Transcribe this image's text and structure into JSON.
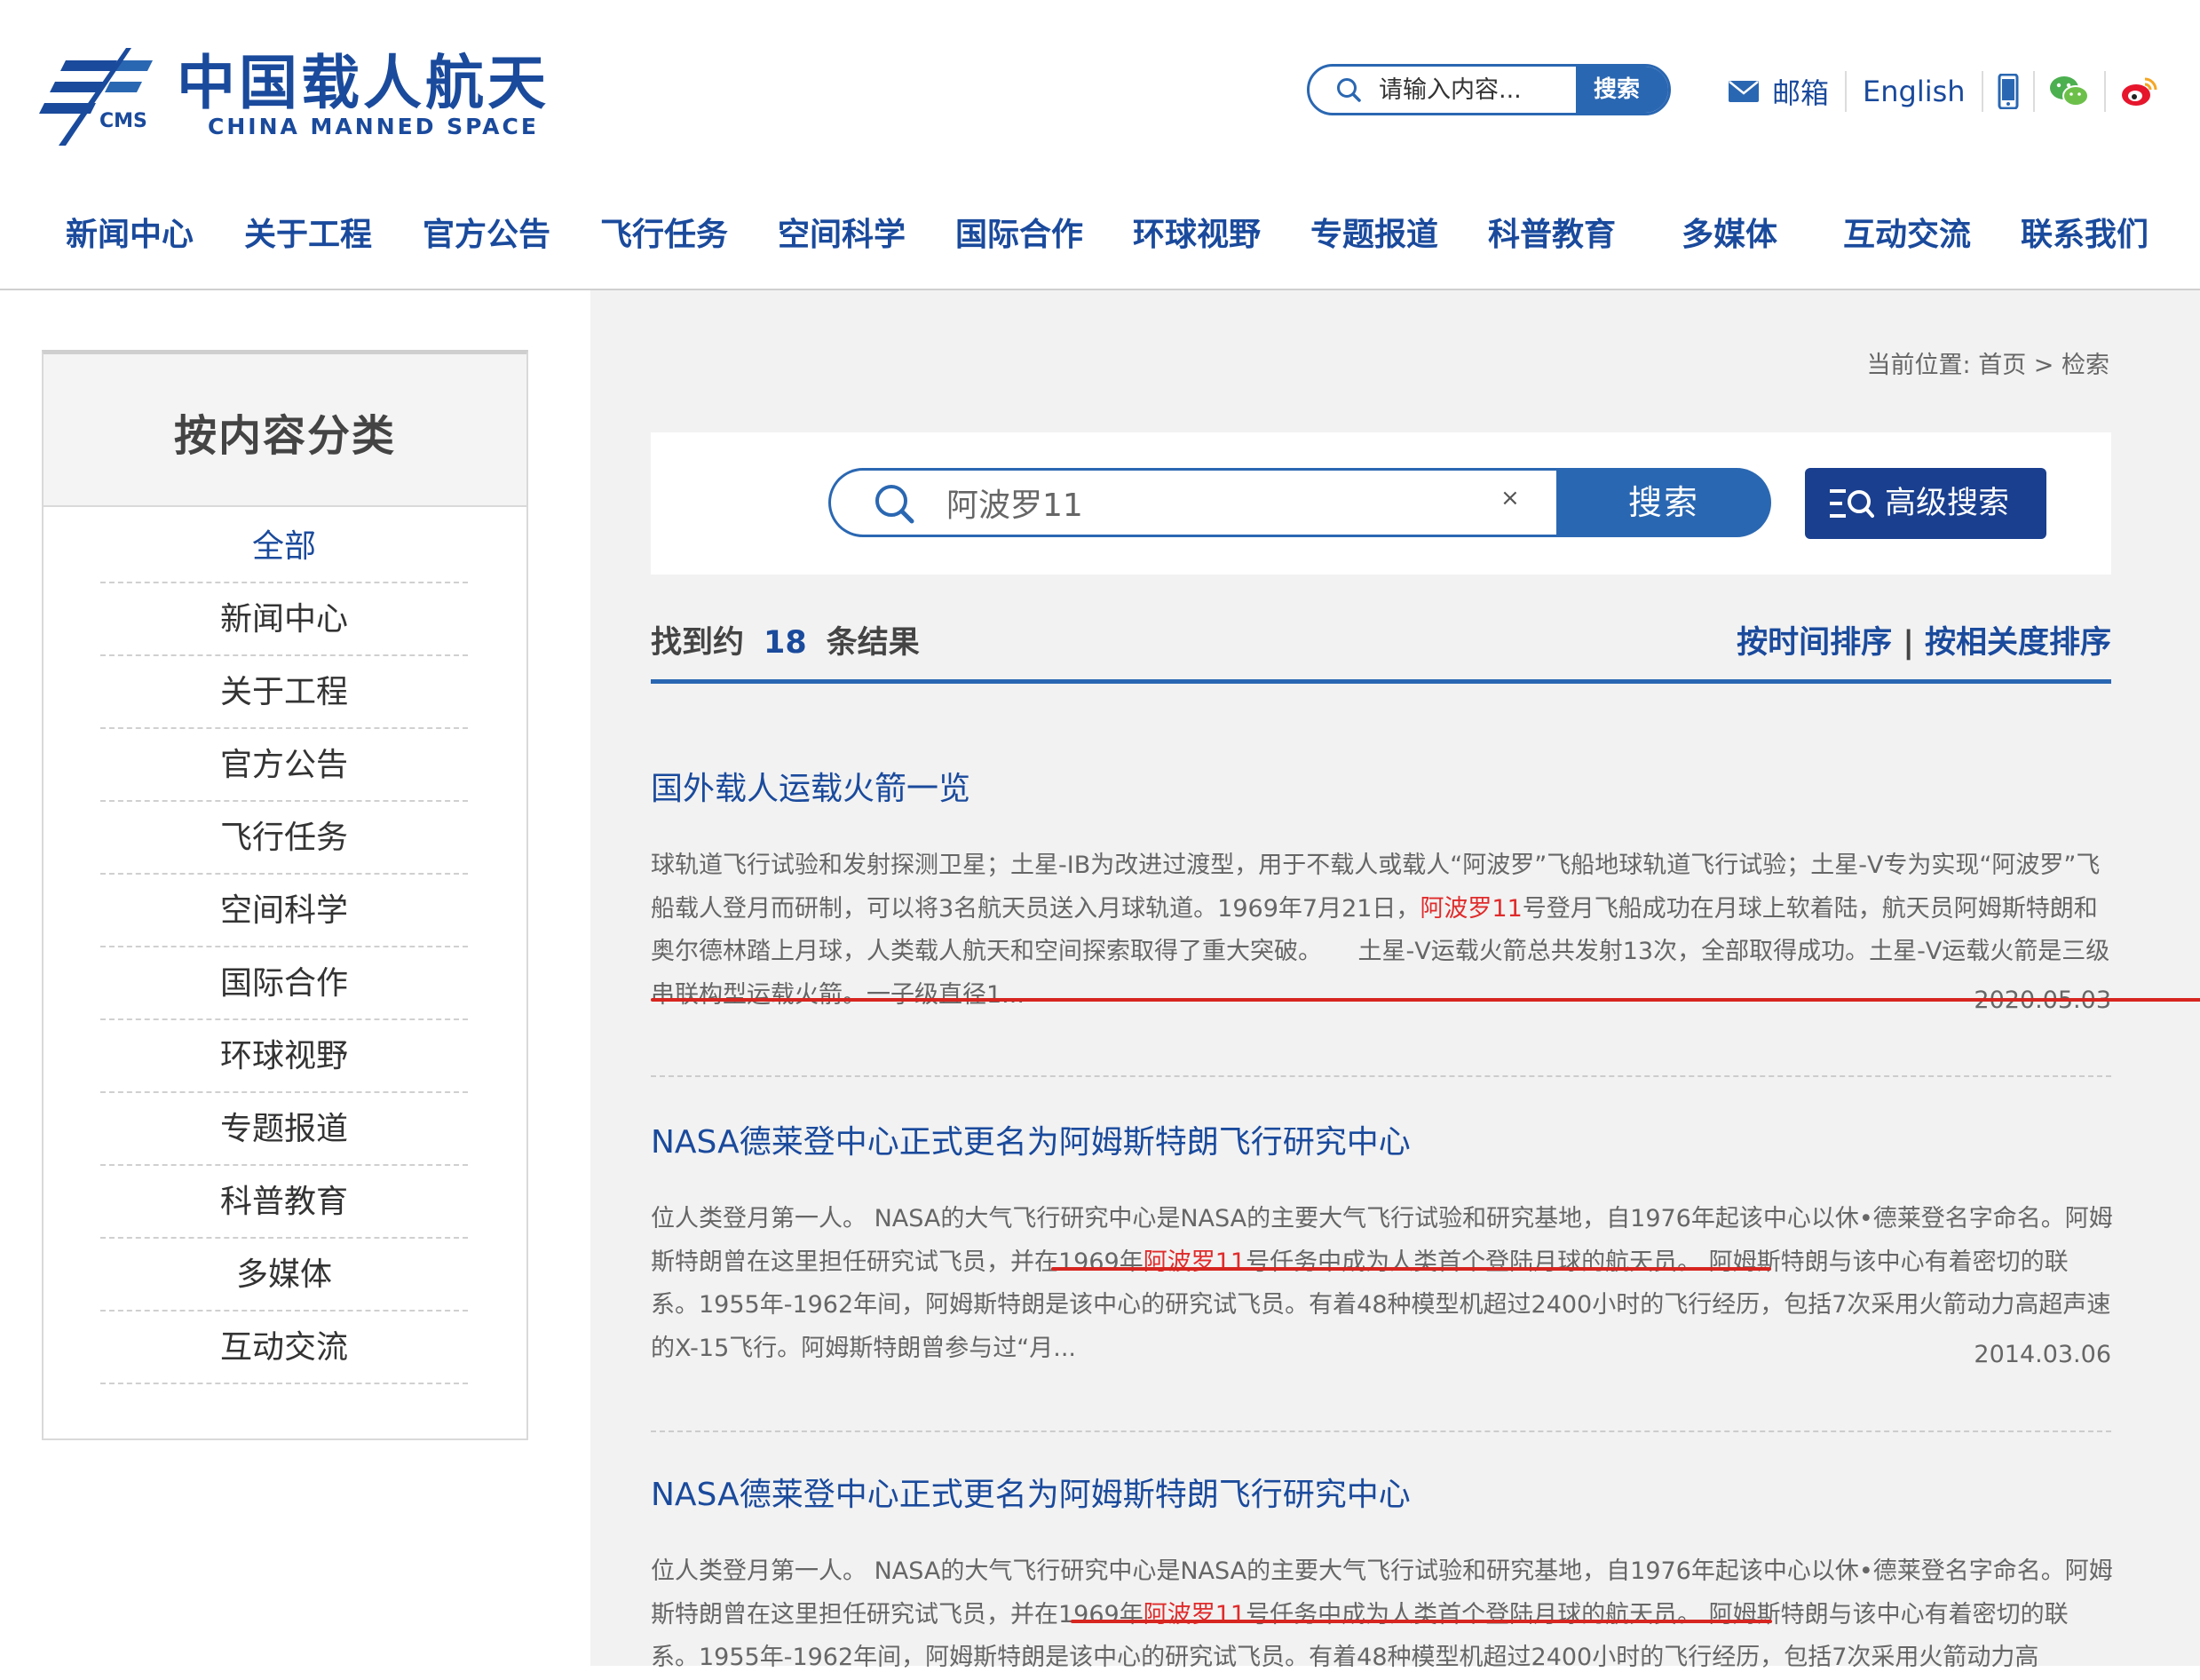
{
  "header": {
    "logo_cn": "中国载人航天",
    "logo_en": "CHINA MANNED SPACE",
    "logo_cms": "CMS",
    "search_placeholder": "请输入内容...",
    "search_button": "搜索",
    "mail_label": "邮箱",
    "english_label": "English",
    "icons": [
      "mail-icon",
      "phone-icon",
      "wechat-icon",
      "weibo-icon"
    ]
  },
  "nav": [
    "新闻中心",
    "关于工程",
    "官方公告",
    "飞行任务",
    "空间科学",
    "国际合作",
    "环球视野",
    "专题报道",
    "科普教育",
    "多媒体",
    "互动交流",
    "联系我们"
  ],
  "sidebar": {
    "title": "按内容分类",
    "items": [
      "全部",
      "新闻中心",
      "关于工程",
      "官方公告",
      "飞行任务",
      "空间科学",
      "国际合作",
      "环球视野",
      "专题报道",
      "科普教育",
      "多媒体",
      "互动交流"
    ],
    "active": "全部"
  },
  "breadcrumb": "当前位置: 首页 > 检索",
  "search": {
    "query": "阿波罗11",
    "clear": "×",
    "button": "搜索",
    "advanced": "高级搜索"
  },
  "results_header": {
    "prefix": "找到约",
    "count": "18",
    "suffix": "条结果",
    "sort_time": "按时间排序",
    "sort_sep": "|",
    "sort_relevance": "按相关度排序"
  },
  "results": [
    {
      "title": "国外载人运载火箭一览",
      "snippet_before": "球轨道飞行试验和发射探测卫星；土星-IB为改进过渡型，用于不载人或载人“阿波罗”飞船地球轨道飞行试验；土星-V专为实现“阿波罗”飞船载人登月而研制，可以将3名航天员送入月球轨道。1969年7月21日，",
      "highlight": "阿波罗11",
      "snippet_after": "号登月飞船成功在月球上软着陆，航天员阿姆斯特朗和奥尔德林踏上月球，人类载人航天和空间探索取得了重大突破。　　土星-V运载火箭总共发射13次，全部取得成功。土星-V运载火箭是三级串联构型运载火箭。一子级直径1...",
      "date": "2020.05.03"
    },
    {
      "title": "NASA德莱登中心正式更名为阿姆斯特朗飞行研究中心",
      "snippet_before": "位人类登月第一人。 NASA的大气飞行研究中心是NASA的主要大气飞行试验和研究基地，自1976年起该中心以休•德莱登名字命名。阿姆斯特朗曾在这里担任研究试飞员，并在1969年",
      "highlight": "阿波罗11",
      "snippet_after": "号任务中成为人类首个登陆月球的航天员。 阿姆斯特朗与该中心有着密切的联系。1955年-1962年间，阿姆斯特朗是该中心的研究试飞员。有着48种模型机超过2400小时的飞行经历，包括7次采用火箭动力高超声速的X-15飞行。阿姆斯特朗曾参与过“月...",
      "date": "2014.03.06"
    },
    {
      "title": "NASA德莱登中心正式更名为阿姆斯特朗飞行研究中心",
      "snippet_before": "位人类登月第一人。 NASA的大气飞行研究中心是NASA的主要大气飞行试验和研究基地，自1976年起该中心以休•德莱登名字命名。阿姆斯特朗曾在这里担任研究试飞员，并在1969年",
      "highlight": "阿波罗11",
      "snippet_after": "号任务中成为人类首个登陆月球的航天员。 阿姆斯特朗与该中心有着密切的联系。1955年-1962年间，阿姆斯特朗是该中心的研究试飞员。有着48种模型机超过2400小时的飞行经历，包括7次采用火箭动力高",
      "date": ""
    }
  ],
  "colors": {
    "brand": "#1a4a9c",
    "search_blue": "#2a67b2",
    "highlight": "#e02b2b",
    "annotation_red": "#d7251f"
  }
}
